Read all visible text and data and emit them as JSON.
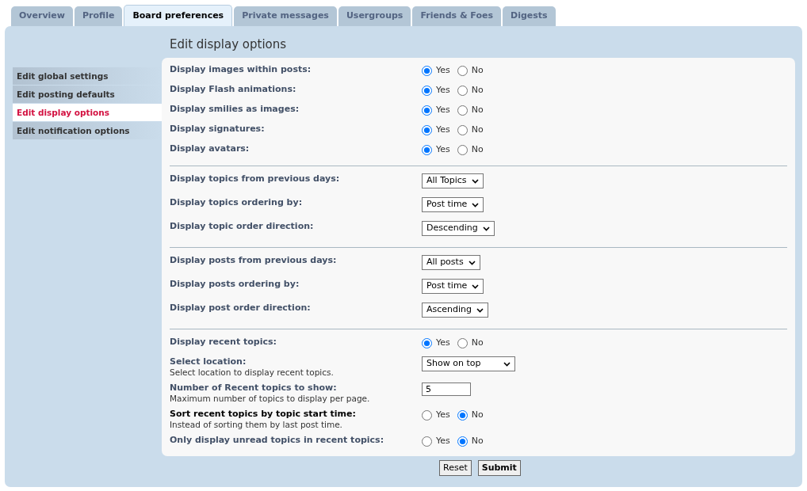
{
  "tabs": [
    {
      "label": "Overview",
      "selected": false
    },
    {
      "label": "Profile",
      "selected": false
    },
    {
      "label": "Board preferences",
      "selected": true
    },
    {
      "label": "Private messages",
      "selected": false
    },
    {
      "label": "Usergroups",
      "selected": false
    },
    {
      "label": "Friends & Foes",
      "selected": false
    },
    {
      "label": "Digests",
      "selected": false
    }
  ],
  "title": "Edit display options",
  "sidebar": {
    "items": [
      {
        "label": "Edit global settings",
        "selected": false
      },
      {
        "label": "Edit posting defaults",
        "selected": false
      },
      {
        "label": "Edit display options",
        "selected": true
      },
      {
        "label": "Edit notification options",
        "selected": false
      }
    ]
  },
  "groups": [
    {
      "rows": [
        {
          "kind": "radio",
          "label": "Display images within posts:",
          "emphasized": false,
          "options": [
            {
              "label": "Yes",
              "selected": true
            },
            {
              "label": "No",
              "selected": false
            }
          ]
        },
        {
          "kind": "radio",
          "label": "Display Flash animations:",
          "emphasized": false,
          "options": [
            {
              "label": "Yes",
              "selected": true
            },
            {
              "label": "No",
              "selected": false
            }
          ]
        },
        {
          "kind": "radio",
          "label": "Display smilies as images:",
          "emphasized": false,
          "options": [
            {
              "label": "Yes",
              "selected": true
            },
            {
              "label": "No",
              "selected": false
            }
          ]
        },
        {
          "kind": "radio",
          "label": "Display signatures:",
          "emphasized": false,
          "options": [
            {
              "label": "Yes",
              "selected": true
            },
            {
              "label": "No",
              "selected": false
            }
          ]
        },
        {
          "kind": "radio",
          "label": "Display avatars:",
          "emphasized": false,
          "options": [
            {
              "label": "Yes",
              "selected": true
            },
            {
              "label": "No",
              "selected": false
            }
          ]
        }
      ]
    },
    {
      "rows": [
        {
          "kind": "select",
          "label": "Display topics from previous days:",
          "emphasized": false,
          "value": "All Topics"
        },
        {
          "kind": "select",
          "label": "Display topics ordering by:",
          "emphasized": false,
          "value": "Post time"
        },
        {
          "kind": "select",
          "label": "Display topic order direction:",
          "emphasized": false,
          "value": "Descending"
        }
      ]
    },
    {
      "rows": [
        {
          "kind": "select",
          "label": "Display posts from previous days:",
          "emphasized": false,
          "value": "All posts"
        },
        {
          "kind": "select",
          "label": "Display posts ordering by:",
          "emphasized": false,
          "value": "Post time"
        },
        {
          "kind": "select",
          "label": "Display post order direction:",
          "emphasized": false,
          "value": "Ascending"
        }
      ]
    },
    {
      "rows": [
        {
          "kind": "radio",
          "label": "Display recent topics:",
          "emphasized": false,
          "options": [
            {
              "label": "Yes",
              "selected": true
            },
            {
              "label": "No",
              "selected": false
            }
          ]
        },
        {
          "kind": "select",
          "label": "Select location:",
          "emphasized": false,
          "explain": "Select location to display recent topics.",
          "value": "Show on top"
        },
        {
          "kind": "text",
          "label": "Number of Recent topics to show:",
          "emphasized": false,
          "explain": "Maximum number of topics to display per page.",
          "value": "5"
        },
        {
          "kind": "radio",
          "label": "Sort recent topics by topic start time:",
          "emphasized": true,
          "explain": "Instead of sorting them by last post time.",
          "options": [
            {
              "label": "Yes",
              "selected": false
            },
            {
              "label": "No",
              "selected": true
            }
          ]
        },
        {
          "kind": "radio",
          "label": "Only display unread topics in recent topics:",
          "emphasized": false,
          "options": [
            {
              "label": "Yes",
              "selected": false
            },
            {
              "label": "No",
              "selected": true
            }
          ]
        }
      ]
    }
  ],
  "buttons": [
    {
      "kind": "reset",
      "label": "Reset"
    },
    {
      "kind": "submit",
      "label": "Submit"
    }
  ]
}
